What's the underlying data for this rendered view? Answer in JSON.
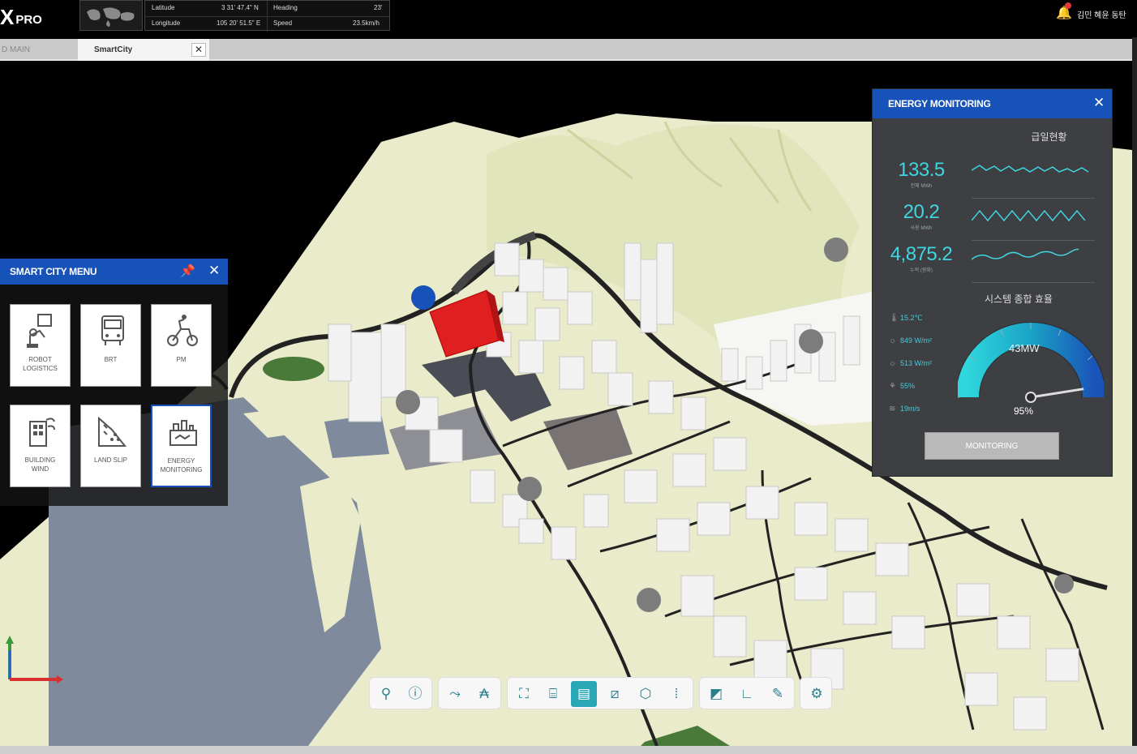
{
  "app": {
    "logo_mark": "X",
    "logo_text": "PRO"
  },
  "gps": {
    "latitude_label": "Latitude",
    "latitude_value": "3 31' 47.4\" N",
    "longitude_label": "Longitude",
    "longitude_value": "105 20' 51.5\" E",
    "heading_label": "Heading",
    "heading_value": "23'",
    "speed_label": "Speed",
    "speed_value": "23.5km/h"
  },
  "user": {
    "name": "김민 혜윤 동탄"
  },
  "tabs": [
    {
      "label": "D MAIN"
    },
    {
      "label": "SmartCity"
    }
  ],
  "smart_city_menu": {
    "title": "SMART CITY MENU",
    "items": [
      {
        "label": "ROBOT\nLOGISTICS",
        "icon": "robot-logistics-icon"
      },
      {
        "label": "BRT",
        "icon": "brt-bus-icon"
      },
      {
        "label": "PM",
        "icon": "personal-mobility-icon"
      },
      {
        "label": "BUILDING\nWIND",
        "icon": "building-wind-icon"
      },
      {
        "label": "LAND SLIP",
        "icon": "land-slip-icon"
      },
      {
        "label": "ENERGY\nMONITORING",
        "icon": "energy-monitoring-icon"
      }
    ]
  },
  "energy_monitoring": {
    "title": "ENERGY MONITORING",
    "supply_title": "급일현황",
    "metrics": [
      {
        "value": "133.5",
        "unit": "전체 MWh"
      },
      {
        "value": "20.2",
        "unit": "사용 MWh"
      },
      {
        "value": "4,875.2",
        "unit": "누적 (원화)"
      }
    ],
    "efficiency_title": "시스템 종합 효율",
    "env": [
      {
        "icon": "thermometer-icon",
        "value": "15.2℃"
      },
      {
        "icon": "solar-icon",
        "value": "849 W/m²"
      },
      {
        "icon": "solar-icon",
        "value": "513 W/m²"
      },
      {
        "icon": "humidity-icon",
        "value": "55%"
      },
      {
        "icon": "wind-icon",
        "value": "19m/s"
      }
    ],
    "gauge": {
      "power": "43MW",
      "percent": "95%",
      "level": 0.95,
      "color": "#22b5c7"
    },
    "button_label": "MONITORING"
  },
  "toolbar": {
    "groups": [
      [
        "hierarchy-icon",
        "alert-icon"
      ],
      [
        "route-icon",
        "text-icon"
      ],
      [
        "scan-icon",
        "cylinder-icon",
        "building-icon",
        "ruler-icon",
        "cube-icon",
        "footprint-icon"
      ],
      [
        "slope-icon",
        "angle-icon",
        "note-icon"
      ],
      [
        "settings-icon"
      ]
    ],
    "active": "building-icon"
  },
  "colors": {
    "brand_blue": "#1652b8",
    "accent_teal": "#3fd6e0",
    "terrain": "#e9ebcb",
    "water": "#7f8b9c",
    "selected_building": "#e02020"
  }
}
